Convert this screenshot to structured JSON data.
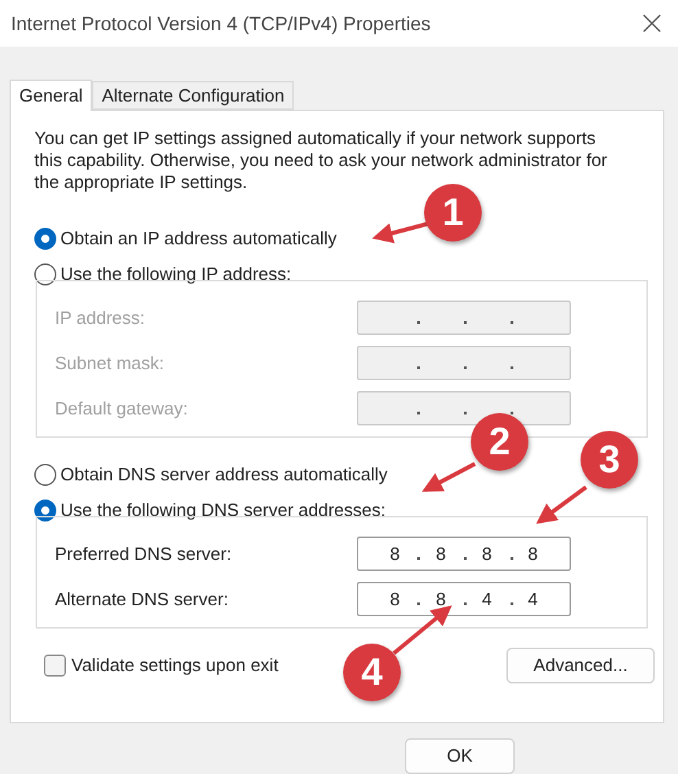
{
  "window": {
    "title": "Internet Protocol Version 4 (TCP/IPv4) Properties"
  },
  "tabs": [
    {
      "label": "General",
      "selected": true
    },
    {
      "label": "Alternate Configuration",
      "selected": false
    }
  ],
  "description": "You can get IP settings assigned automatically if your network supports this capability. Otherwise, you need to ask your network administrator for the appropriate IP settings.",
  "ip_options": [
    {
      "label": "Obtain an IP address automatically",
      "selected": true
    },
    {
      "label": "Use the following IP address:",
      "selected": false
    }
  ],
  "ip_fields": {
    "disabled": true,
    "rows": [
      {
        "label": "IP address:",
        "octets": []
      },
      {
        "label": "Subnet mask:",
        "octets": []
      },
      {
        "label": "Default gateway:",
        "octets": []
      }
    ]
  },
  "dns_options": [
    {
      "label": "Obtain DNS server address automatically",
      "selected": false
    },
    {
      "label": "Use the following DNS server addresses:",
      "selected": true
    }
  ],
  "dns_fields": {
    "disabled": false,
    "rows": [
      {
        "label": "Preferred DNS server:",
        "octets": [
          "8",
          "8",
          "8",
          "8"
        ]
      },
      {
        "label": "Alternate DNS server:",
        "octets": [
          "8",
          "8",
          "4",
          "4"
        ]
      }
    ]
  },
  "validate": {
    "label": "Validate settings upon exit",
    "checked": false
  },
  "advanced_button": "Advanced...",
  "ok_button": "OK",
  "callouts": [
    {
      "number": "1"
    },
    {
      "number": "2"
    },
    {
      "number": "3"
    },
    {
      "number": "4"
    }
  ]
}
